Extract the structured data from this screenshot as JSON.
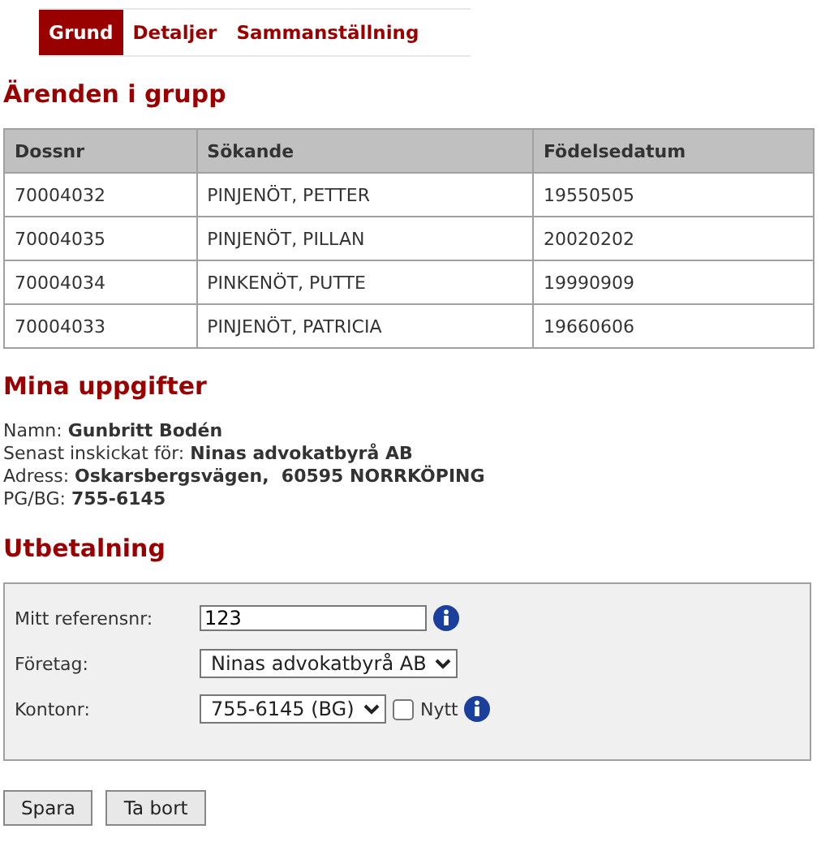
{
  "tabs": [
    {
      "label": "Grund",
      "selected": true
    },
    {
      "label": "Detaljer",
      "selected": false
    },
    {
      "label": "Sammanställning",
      "selected": false
    }
  ],
  "group_heading": "Ärenden i grupp",
  "table": {
    "columns": [
      "Dossnr",
      "Sökande",
      "Födelsedatum"
    ],
    "rows": [
      [
        "70004032",
        "PINJENÖT, PETTER",
        "19550505"
      ],
      [
        "70004035",
        "PINJENÖT, PILLAN",
        "20020202"
      ],
      [
        "70004034",
        "PINKENÖT, PUTTE",
        "19990909"
      ],
      [
        "70004033",
        "PINJENÖT, PATRICIA",
        "19660606"
      ]
    ]
  },
  "details_heading": "Mina uppgifter",
  "details": [
    {
      "label": "Namn:",
      "value": "Gunbritt Bodén"
    },
    {
      "label": "Senast inskickat för:",
      "value": "Ninas advokatbyrå AB"
    },
    {
      "label": "Adress:",
      "value": "Oskarsbergsvägen,  60595 NORRKÖPING"
    },
    {
      "label": "PG/BG:",
      "value": "755-6145"
    }
  ],
  "payment_heading": "Utbetalning",
  "payment": {
    "reference": {
      "label": "Mitt referensnr:",
      "value": "123"
    },
    "company": {
      "label": "Företag:",
      "value": "Ninas advokatbyrå AB"
    },
    "account": {
      "label": "Kontonr:",
      "value": "755-6145 (BG)",
      "new_label": "Nytt",
      "new_checked": false
    }
  },
  "buttons": [
    "Spara",
    "Ta bort"
  ]
}
